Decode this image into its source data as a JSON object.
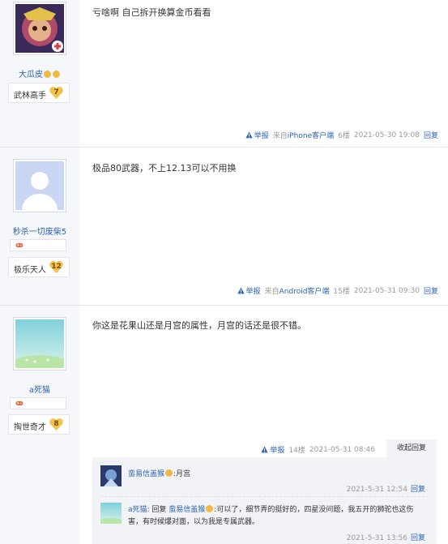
{
  "posts": [
    {
      "username": "大瓜皮",
      "rank_title": "武林高手",
      "rank_level": "7",
      "content": "亏啥啊 自己拆开换算金币看看",
      "report": "举报",
      "via_prefix": "来自",
      "via_device": "iPhone客户端",
      "floor": "6楼",
      "time": "2021-05-30 19:08",
      "reply": "回复"
    },
    {
      "username": "秒杀一切废柴5",
      "rank_title": "极乐天人",
      "rank_level": "12",
      "content": "极品80武器，不上12.13可以不用换",
      "report": "举报",
      "via_prefix": "来自",
      "via_device": "Android客户端",
      "floor": "15楼",
      "time": "2021-05-31 09:30",
      "reply": "回复"
    },
    {
      "username": "a死猫",
      "rank_title": "掏世奇才",
      "rank_level": "8",
      "content": "你这是花果山还是月宫的属性，月宫的话还是很不错。",
      "report": "举报",
      "floor": "14楼",
      "time": "2021-05-31 08:46",
      "fold_label": "收起回复"
    }
  ],
  "replies": [
    {
      "name": "蛮易信盖猴",
      "text": ":月宫",
      "time": "2021-5-31 12:54",
      "reply": "回复"
    },
    {
      "name": "a死猫",
      "prefix": ": 回复 ",
      "target": "蛮易信盖猴",
      "text": ":可以了，细节弄的挺好的，四星没问题，我五开的狮驼也这伤害，有时候爆对面，以为我是专属武器。",
      "time": "2021-5-31 13:56",
      "reply": "回复"
    }
  ],
  "colors": {
    "link": "#2d64b3",
    "sidebar_bg": "#f6f7fb",
    "reply_bg": "#f2f3f7"
  },
  "icons": [
    "warning-icon",
    "game-controller-icon",
    "emoji-icon",
    "level-heart-icon"
  ]
}
